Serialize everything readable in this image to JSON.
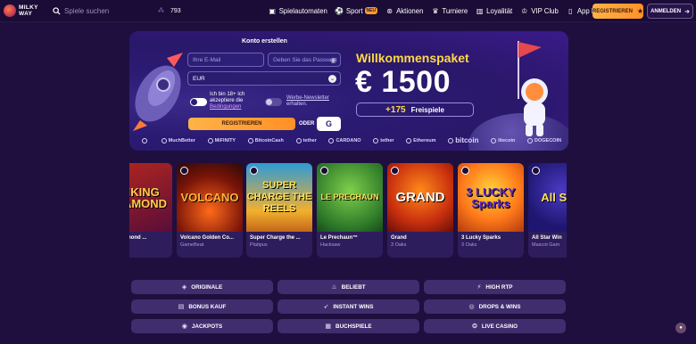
{
  "brand": {
    "line1": "MILKY",
    "line2": "WAY"
  },
  "search": {
    "placeholder": "Spiele suchen"
  },
  "online_count": "793",
  "nav": [
    {
      "label": "Spielautomaten",
      "icon": "slot-machine-icon"
    },
    {
      "label": "Sport",
      "icon": "soccer-ball-icon",
      "badge": "NEU"
    },
    {
      "label": "Aktionen",
      "icon": "gift-icon"
    },
    {
      "label": "Turniere",
      "icon": "trophy-icon"
    },
    {
      "label": "Loyalität",
      "icon": "chart-icon"
    },
    {
      "label": "VIP Club",
      "icon": "crown-icon"
    },
    {
      "label": "App holen",
      "icon": "phone-icon"
    }
  ],
  "header_buttons": {
    "register": "REGISTRIEREN",
    "login": "ANMELDEN"
  },
  "signup": {
    "title": "Konto erstellen",
    "email_placeholder": "Ihre E-Mail",
    "password_placeholder": "Geben Sie das Passwort",
    "currency": "EUR",
    "terms_text": "Ich bin 18+ Ich akzeptiere die",
    "terms_link": "Bedingungen",
    "newsletter_link": "Werbe-Newsletter",
    "newsletter_text": "erhalten.",
    "submit": "REGISTRIEREN",
    "or": "ODER",
    "google": "G"
  },
  "promo": {
    "title": "Willkommenspaket",
    "amount": "€ 1500",
    "spins_count": "+175",
    "spins_label": "Freispiele"
  },
  "payments": [
    "MuchBetter",
    "MiFINITY",
    "BitcoinCash",
    "tether",
    "CARDANO",
    "tether",
    "Ethereum",
    "bitcoin",
    "litecoin",
    "DOGECOIN"
  ],
  "games": [
    {
      "title": "ng Diamond ...",
      "provider": "",
      "thumb": "RIKING DIAMOND"
    },
    {
      "title": "Volcano Golden Co...",
      "provider": "GameBeat",
      "thumb": "VOLCANO"
    },
    {
      "title": "Super Charge the ...",
      "provider": "Platipus",
      "thumb": "SUPER CHARGE THE REELS"
    },
    {
      "title": "Le Prechaun™",
      "provider": "Hacksaw",
      "thumb": "LE PRECHAUN"
    },
    {
      "title": "Grand",
      "provider": "3 Oaks",
      "thumb": "GRAND"
    },
    {
      "title": "3 Lucky Sparks",
      "provider": "3 Oaks",
      "thumb": "3 LUCKY Sparks"
    },
    {
      "title": "All Star Win",
      "provider": "Mascot Gam",
      "thumb": "All Star"
    }
  ],
  "categories": [
    {
      "label": "ORIGINALE",
      "icon": "shield-icon"
    },
    {
      "label": "BELIEBT",
      "icon": "fire-icon"
    },
    {
      "label": "HIGH RTP",
      "icon": "bolt-icon"
    },
    {
      "label": "BONUS KAUF",
      "icon": "cart-icon"
    },
    {
      "label": "INSTANT WINS",
      "icon": "rocket-icon"
    },
    {
      "label": "DROPS & WINS",
      "icon": "coin-icon"
    },
    {
      "label": "JACKPOTS",
      "icon": "eye-icon"
    },
    {
      "label": "BUCHSPIELE",
      "icon": "book-icon"
    },
    {
      "label": "LIVE CASINO",
      "icon": "chip-icon"
    }
  ],
  "colors": {
    "accent": "#ff9d2e",
    "background": "#1f0f3f",
    "promo_yellow": "#ffd84a"
  }
}
